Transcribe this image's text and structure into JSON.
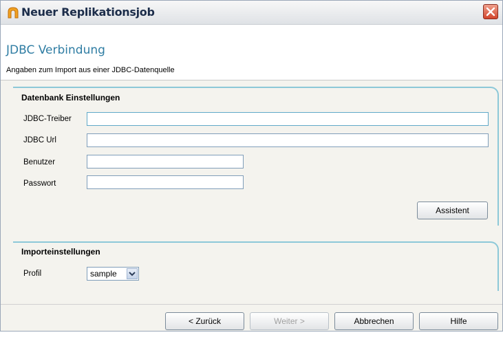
{
  "window": {
    "title": "Neuer Replikationsjob"
  },
  "header": {
    "title": "JDBC Verbindung",
    "subtitle": "Angaben zum Import aus einer JDBC-Datenquelle"
  },
  "db_settings": {
    "group_label": "Datenbank Einstellungen",
    "driver_label": "JDBC-Treiber",
    "url_label": "JDBC Url",
    "user_label": "Benutzer",
    "password_label": "Passwort",
    "driver_value": "",
    "url_value": "",
    "user_value": "",
    "password_value": "",
    "assistant_button": "Assistent"
  },
  "import_settings": {
    "group_label": "Importeinstellungen",
    "profile_label": "Profil",
    "profile_value": "sample"
  },
  "footer": {
    "back": "< Zurück",
    "next": "Weiter >",
    "cancel": "Abbrechen",
    "help": "Hilfe"
  },
  "colors": {
    "accent": "#2f7da3",
    "group_border": "#8cc8d8",
    "close": "#d2452c"
  },
  "icons": {
    "app": "app-icon",
    "close": "close-icon",
    "dropdown": "chevron-down-icon"
  }
}
